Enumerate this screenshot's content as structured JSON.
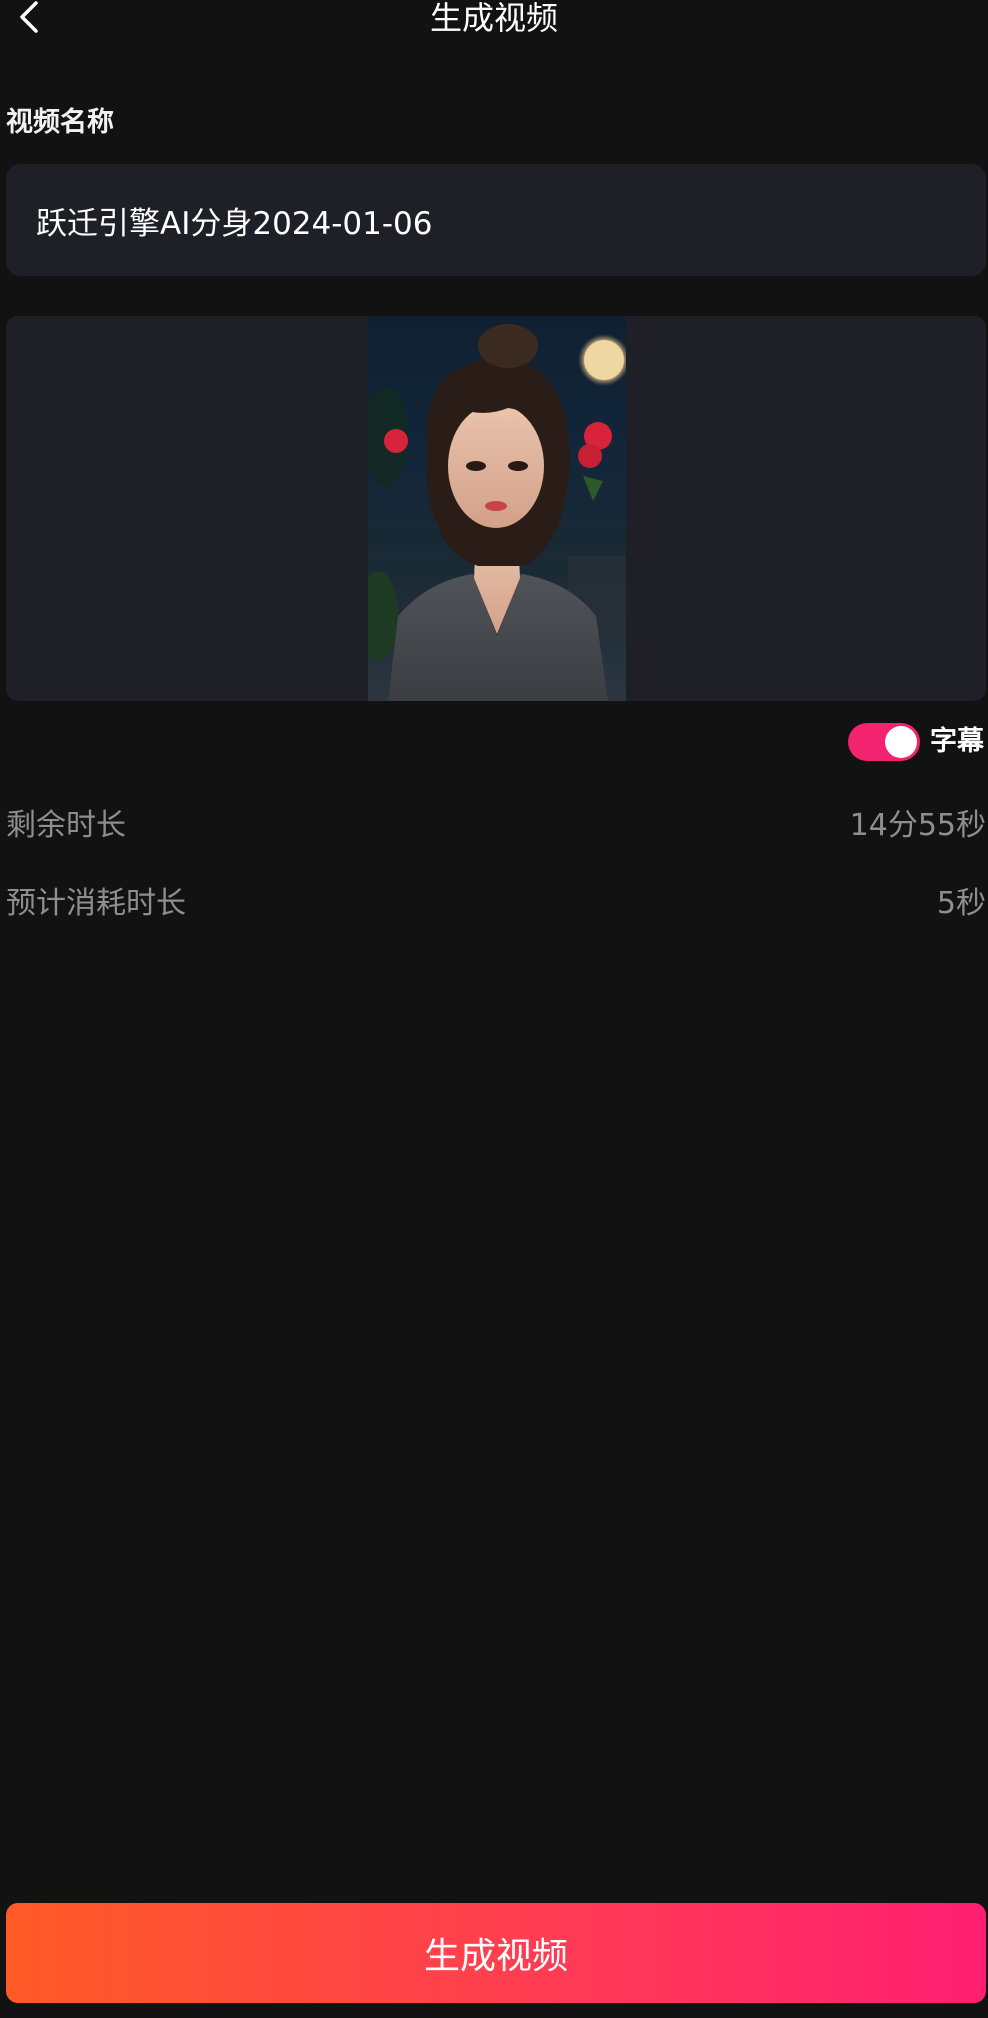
{
  "header": {
    "title": "生成视频",
    "back_icon": "chevron-left-icon"
  },
  "form": {
    "name_label": "视频名称",
    "name_value": "跃迁引擎AI分身2024-01-06"
  },
  "preview": {
    "description": "avatar portrait"
  },
  "subtitle": {
    "label": "字幕",
    "enabled": true,
    "accent_color": "#f3236f"
  },
  "info": {
    "remaining_label": "剩余时长",
    "remaining_value": "14分55秒",
    "estimate_label": "预计消耗时长",
    "estimate_value": "5秒"
  },
  "action": {
    "generate_label": "生成视频",
    "gradient_start": "#ff5a26",
    "gradient_end": "#ff1f72"
  }
}
